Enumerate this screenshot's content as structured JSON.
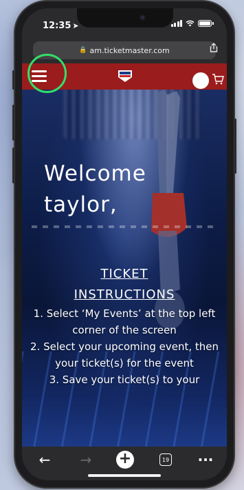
{
  "status_bar": {
    "time": "12:35",
    "location_glyph": "➤"
  },
  "browser": {
    "url": "am.ticketmaster.com",
    "open_tabs": "19"
  },
  "hero": {
    "welcome_line1": "Welcome",
    "welcome_line2": "taylor,",
    "instructions_title": "TICKET INSTRUCTIONS",
    "steps": [
      "1. Select ‘My Events’ at the top left corner of the screen",
      "2. Select your upcoming event, then your ticket(s) for the event",
      "3. Save your ticket(s) to your"
    ]
  },
  "colors": {
    "header_red": "#9b1c1c",
    "highlight_green": "#33e06a",
    "browser_chrome": "#2b2b2d"
  },
  "icons": [
    "location-arrow-icon",
    "signal-icon",
    "wifi-icon",
    "battery-icon",
    "lock-icon",
    "share-icon",
    "hamburger-menu-icon",
    "team-logo-icon",
    "cart-icon",
    "back-arrow-icon",
    "forward-arrow-icon",
    "new-tab-plus-icon",
    "tabs-icon",
    "more-icon"
  ]
}
